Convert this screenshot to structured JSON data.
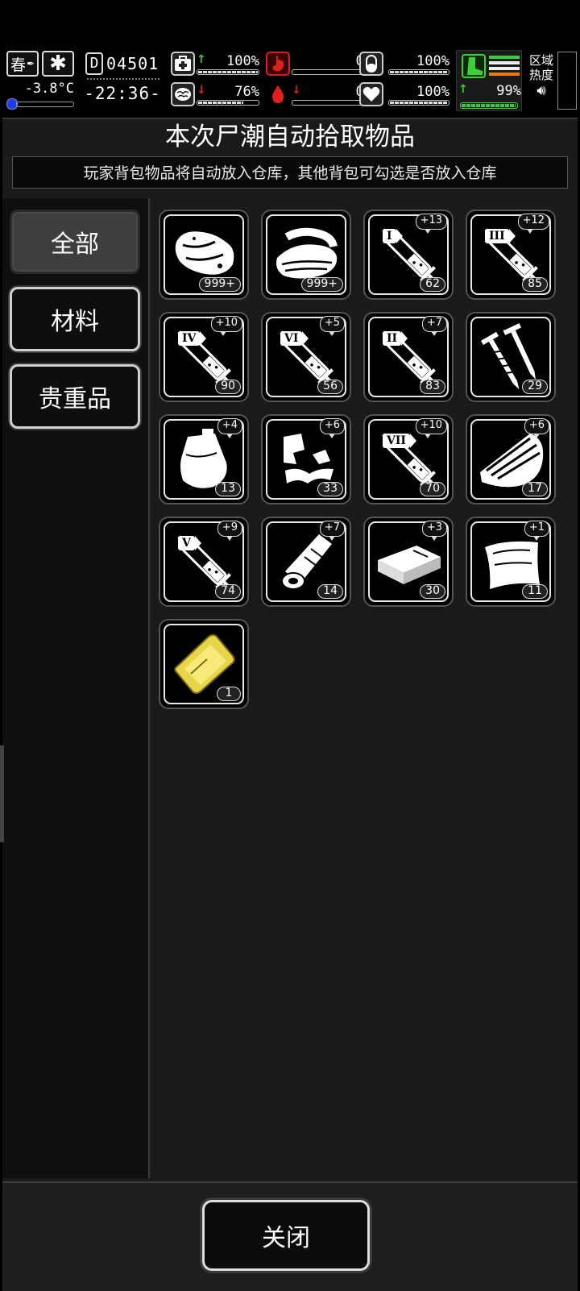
{
  "hud": {
    "season": "春",
    "temperature": "-3.8°C",
    "day_counter": "04501",
    "day_prefix": "D",
    "clock": "-22:36-",
    "stats": {
      "health": "100%",
      "brain": "76%",
      "stomach": "0%",
      "blood": "0%",
      "pill": "100%",
      "heart": "100%",
      "stamina": "99%"
    },
    "zone_heat_line1": "区域",
    "zone_heat_line2": "热度",
    "colors": {
      "up": "#3ad03a",
      "down": "#e02020",
      "stamina": "#2fd12f"
    }
  },
  "panel": {
    "title": "本次尸潮自动拾取物品",
    "subtitle": "玩家背包物品将自动放入仓库，其他背包可勾选是否放入仓库"
  },
  "tabs": [
    {
      "label": "全部",
      "active": true
    },
    {
      "label": "材料",
      "active": false
    },
    {
      "label": "贵重品",
      "active": false
    }
  ],
  "items": [
    {
      "icon": "meat-icon",
      "count": "999+",
      "level": ""
    },
    {
      "icon": "cloth-icon",
      "count": "999+",
      "level": ""
    },
    {
      "icon": "syringe-icon",
      "roman": "I",
      "count": "62",
      "level": "+13"
    },
    {
      "icon": "syringe-icon",
      "roman": "III",
      "count": "85",
      "level": "+12"
    },
    {
      "icon": "syringe-icon",
      "roman": "IV",
      "count": "90",
      "level": "+10"
    },
    {
      "icon": "syringe-icon",
      "roman": "VI",
      "count": "56",
      "level": "+5"
    },
    {
      "icon": "syringe-icon",
      "roman": "II",
      "count": "83",
      "level": "+7"
    },
    {
      "icon": "nails-icon",
      "count": "29",
      "level": ""
    },
    {
      "icon": "bag-icon",
      "count": "13",
      "level": "+4"
    },
    {
      "icon": "scrap-icon",
      "count": "33",
      "level": "+6"
    },
    {
      "icon": "syringe-icon",
      "roman": "VII",
      "count": "70",
      "level": "+10"
    },
    {
      "icon": "wood-icon",
      "count": "17",
      "level": "+6"
    },
    {
      "icon": "syringe-icon",
      "roman": "V",
      "count": "74",
      "level": "+9"
    },
    {
      "icon": "bandage-roll-icon",
      "count": "14",
      "level": "+7"
    },
    {
      "icon": "brick-icon",
      "count": "30",
      "level": "+3"
    },
    {
      "icon": "paper-icon",
      "count": "11",
      "level": "+1"
    },
    {
      "icon": "gold-card-icon",
      "count": "1",
      "level": ""
    }
  ],
  "close_label": "关闭"
}
